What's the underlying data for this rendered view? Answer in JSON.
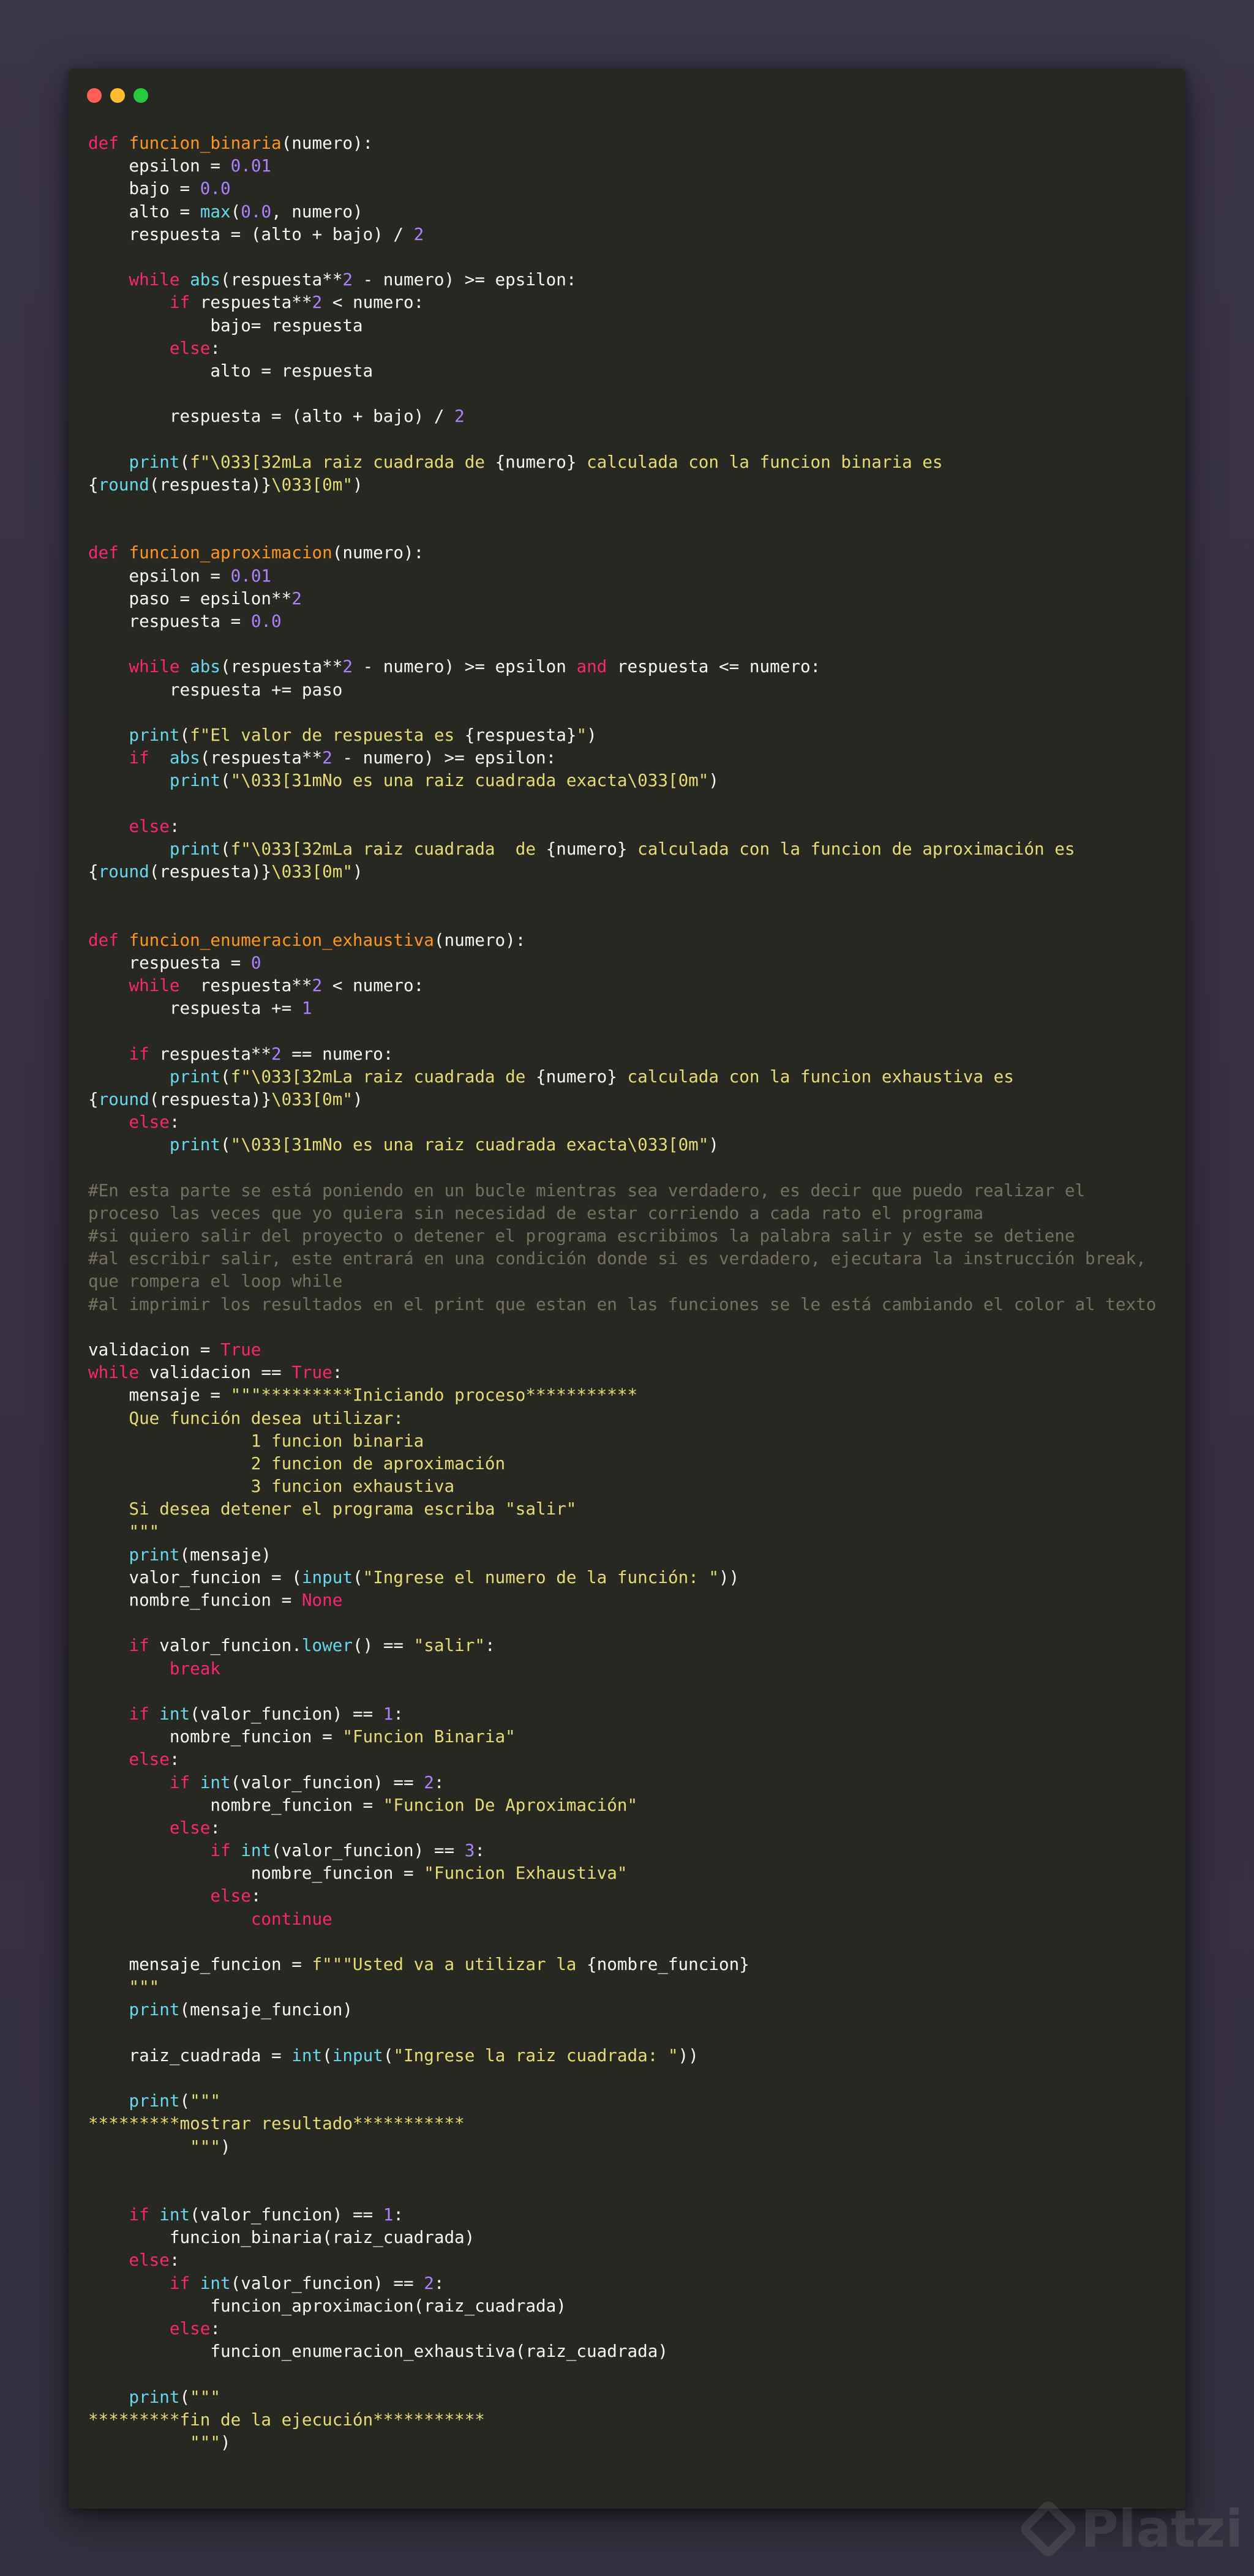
{
  "window": {
    "controls": [
      "close",
      "minimize",
      "maximize"
    ],
    "background": "#272822"
  },
  "theme": {
    "keyword": "#f92672",
    "function_name": "#fd971f",
    "builtin": "#66d9ef",
    "number": "#ae81ff",
    "string": "#e6db74",
    "comment": "#75715e",
    "text": "#f8f8f2"
  },
  "code_lines": [
    [
      [
        "kw",
        "def "
      ],
      [
        "fn",
        "funcion_binaria"
      ],
      [
        "",
        "(numero):"
      ]
    ],
    [
      [
        "",
        "    epsilon = "
      ],
      [
        "nm",
        "0.01"
      ]
    ],
    [
      [
        "",
        "    bajo = "
      ],
      [
        "nm",
        "0.0"
      ]
    ],
    [
      [
        "",
        "    alto = "
      ],
      [
        "bi",
        "max"
      ],
      [
        "",
        "("
      ],
      [
        "nm",
        "0.0"
      ],
      [
        "",
        ", numero)"
      ]
    ],
    [
      [
        "",
        "    respuesta = (alto + bajo) / "
      ],
      [
        "nm",
        "2"
      ]
    ],
    [],
    [
      [
        "",
        "    "
      ],
      [
        "kw",
        "while "
      ],
      [
        "bi",
        "abs"
      ],
      [
        "",
        "(respuesta**"
      ],
      [
        "nm",
        "2"
      ],
      [
        "",
        " - numero) >= epsilon:"
      ]
    ],
    [
      [
        "",
        "        "
      ],
      [
        "kw",
        "if "
      ],
      [
        "",
        "respuesta**"
      ],
      [
        "nm",
        "2"
      ],
      [
        "",
        " < numero:"
      ]
    ],
    [
      [
        "",
        "            bajo= respuesta"
      ]
    ],
    [
      [
        "",
        "        "
      ],
      [
        "kw",
        "else"
      ],
      [
        "",
        ":"
      ]
    ],
    [
      [
        "",
        "            alto = respuesta"
      ]
    ],
    [],
    [
      [
        "",
        "        respuesta = (alto + bajo) / "
      ],
      [
        "nm",
        "2"
      ]
    ],
    [],
    [
      [
        "",
        "    "
      ],
      [
        "bi",
        "print"
      ],
      [
        "",
        "("
      ],
      [
        "st",
        "f\"\\033[32mLa raiz cuadrada de "
      ],
      [
        "",
        "{numero}"
      ],
      [
        "st",
        " calculada con la funcion binaria es"
      ]
    ],
    [
      [
        "",
        "{"
      ],
      [
        "bi",
        "round"
      ],
      [
        "",
        "(respuesta)}"
      ],
      [
        "st",
        "\\033[0m\""
      ],
      [
        "",
        ")"
      ]
    ],
    [],
    [],
    [
      [
        "kw",
        "def "
      ],
      [
        "fn",
        "funcion_aproximacion"
      ],
      [
        "",
        "(numero):"
      ]
    ],
    [
      [
        "",
        "    epsilon = "
      ],
      [
        "nm",
        "0.01"
      ]
    ],
    [
      [
        "",
        "    paso = epsilon**"
      ],
      [
        "nm",
        "2"
      ]
    ],
    [
      [
        "",
        "    respuesta = "
      ],
      [
        "nm",
        "0.0"
      ]
    ],
    [],
    [
      [
        "",
        "    "
      ],
      [
        "kw",
        "while "
      ],
      [
        "bi",
        "abs"
      ],
      [
        "",
        "(respuesta**"
      ],
      [
        "nm",
        "2"
      ],
      [
        "",
        " - numero) >= epsilon "
      ],
      [
        "kw",
        "and"
      ],
      [
        "",
        " respuesta <= numero:"
      ]
    ],
    [
      [
        "",
        "        respuesta += paso"
      ]
    ],
    [],
    [
      [
        "",
        "    "
      ],
      [
        "bi",
        "print"
      ],
      [
        "",
        "("
      ],
      [
        "st",
        "f\"El valor de respuesta es "
      ],
      [
        "",
        "{respuesta}"
      ],
      [
        "st",
        "\""
      ],
      [
        "",
        ")"
      ]
    ],
    [
      [
        "",
        "    "
      ],
      [
        "kw",
        "if"
      ],
      [
        "",
        "  "
      ],
      [
        "bi",
        "abs"
      ],
      [
        "",
        "(respuesta**"
      ],
      [
        "nm",
        "2"
      ],
      [
        "",
        " - numero) >= epsilon:"
      ]
    ],
    [
      [
        "",
        "        "
      ],
      [
        "bi",
        "print"
      ],
      [
        "",
        "("
      ],
      [
        "st",
        "\"\\033[31mNo es una raiz cuadrada exacta\\033[0m\""
      ],
      [
        "",
        ")"
      ]
    ],
    [],
    [
      [
        "",
        "    "
      ],
      [
        "kw",
        "else"
      ],
      [
        "",
        ":"
      ]
    ],
    [
      [
        "",
        "        "
      ],
      [
        "bi",
        "print"
      ],
      [
        "",
        "("
      ],
      [
        "st",
        "f\"\\033[32mLa raiz cuadrada  de "
      ],
      [
        "",
        "{numero}"
      ],
      [
        "st",
        " calculada con la funcion de aproximación es"
      ]
    ],
    [
      [
        "",
        "{"
      ],
      [
        "bi",
        "round"
      ],
      [
        "",
        "(respuesta)}"
      ],
      [
        "st",
        "\\033[0m\""
      ],
      [
        "",
        ")"
      ]
    ],
    [],
    [],
    [
      [
        "kw",
        "def "
      ],
      [
        "fn",
        "funcion_enumeracion_exhaustiva"
      ],
      [
        "",
        "(numero):"
      ]
    ],
    [
      [
        "",
        "    respuesta = "
      ],
      [
        "nm",
        "0"
      ]
    ],
    [
      [
        "",
        "    "
      ],
      [
        "kw",
        "while"
      ],
      [
        "",
        "  respuesta**"
      ],
      [
        "nm",
        "2"
      ],
      [
        "",
        " < numero:"
      ]
    ],
    [
      [
        "",
        "        respuesta += "
      ],
      [
        "nm",
        "1"
      ]
    ],
    [],
    [
      [
        "",
        "    "
      ],
      [
        "kw",
        "if "
      ],
      [
        "",
        "respuesta**"
      ],
      [
        "nm",
        "2"
      ],
      [
        "",
        " == numero:"
      ]
    ],
    [
      [
        "",
        "        "
      ],
      [
        "bi",
        "print"
      ],
      [
        "",
        "("
      ],
      [
        "st",
        "f\"\\033[32mLa raiz cuadrada de "
      ],
      [
        "",
        "{numero}"
      ],
      [
        "st",
        " calculada con la funcion exhaustiva es"
      ]
    ],
    [
      [
        "",
        "{"
      ],
      [
        "bi",
        "round"
      ],
      [
        "",
        "(respuesta)}"
      ],
      [
        "st",
        "\\033[0m\""
      ],
      [
        "",
        ")"
      ]
    ],
    [
      [
        "",
        "    "
      ],
      [
        "kw",
        "else"
      ],
      [
        "",
        ":"
      ]
    ],
    [
      [
        "",
        "        "
      ],
      [
        "bi",
        "print"
      ],
      [
        "",
        "("
      ],
      [
        "st",
        "\"\\033[31mNo es una raiz cuadrada exacta\\033[0m\""
      ],
      [
        "",
        ")"
      ]
    ],
    [],
    [
      [
        "cm",
        "#En esta parte se está poniendo en un bucle mientras sea verdadero, es decir que puedo realizar el"
      ]
    ],
    [
      [
        "cm",
        "proceso las veces que yo quiera sin necesidad de estar corriendo a cada rato el programa"
      ]
    ],
    [
      [
        "cm",
        "#si quiero salir del proyecto o detener el programa escribimos la palabra salir y este se detiene"
      ]
    ],
    [
      [
        "cm",
        "#al escribir salir, este entrará en una condición donde si es verdadero, ejecutara la instrucción break,"
      ]
    ],
    [
      [
        "cm",
        "que rompera el loop while"
      ]
    ],
    [
      [
        "cm",
        "#al imprimir los resultados en el print que estan en las funciones se le está cambiando el color al texto"
      ]
    ],
    [],
    [
      [
        "",
        "validacion = "
      ],
      [
        "kw",
        "True"
      ]
    ],
    [
      [
        "kw",
        "while"
      ],
      [
        "",
        " validacion == "
      ],
      [
        "kw",
        "True"
      ],
      [
        "",
        ":"
      ]
    ],
    [
      [
        "",
        "    mensaje = "
      ],
      [
        "st",
        "\"\"\"*********Iniciando proceso***********"
      ]
    ],
    [
      [
        "st",
        "    Que función desea utilizar:"
      ]
    ],
    [
      [
        "st",
        "                1 funcion binaria"
      ]
    ],
    [
      [
        "st",
        "                2 funcion de aproximación"
      ]
    ],
    [
      [
        "st",
        "                3 funcion exhaustiva"
      ]
    ],
    [
      [
        "st",
        "    Si desea detener el programa escriba \"salir\""
      ]
    ],
    [
      [
        "st",
        "    \"\"\""
      ]
    ],
    [
      [
        "",
        "    "
      ],
      [
        "bi",
        "print"
      ],
      [
        "",
        "(mensaje)"
      ]
    ],
    [
      [
        "",
        "    valor_funcion = ("
      ],
      [
        "bi",
        "input"
      ],
      [
        "",
        "("
      ],
      [
        "st",
        "\"Ingrese el numero de la función: \""
      ],
      [
        "",
        "))"
      ]
    ],
    [
      [
        "",
        "    nombre_funcion = "
      ],
      [
        "kw",
        "None"
      ]
    ],
    [],
    [
      [
        "",
        "    "
      ],
      [
        "kw",
        "if "
      ],
      [
        "",
        "valor_funcion."
      ],
      [
        "bi",
        "lower"
      ],
      [
        "",
        "() == "
      ],
      [
        "st",
        "\"salir\""
      ],
      [
        "",
        ":"
      ]
    ],
    [
      [
        "",
        "        "
      ],
      [
        "kw",
        "break"
      ]
    ],
    [],
    [
      [
        "",
        "    "
      ],
      [
        "kw",
        "if "
      ],
      [
        "bi",
        "int"
      ],
      [
        "",
        "(valor_funcion) == "
      ],
      [
        "nm",
        "1"
      ],
      [
        "",
        ":"
      ]
    ],
    [
      [
        "",
        "        nombre_funcion = "
      ],
      [
        "st",
        "\"Funcion Binaria\""
      ]
    ],
    [
      [
        "",
        "    "
      ],
      [
        "kw",
        "else"
      ],
      [
        "",
        ":"
      ]
    ],
    [
      [
        "",
        "        "
      ],
      [
        "kw",
        "if "
      ],
      [
        "bi",
        "int"
      ],
      [
        "",
        "(valor_funcion) == "
      ],
      [
        "nm",
        "2"
      ],
      [
        "",
        ":"
      ]
    ],
    [
      [
        "",
        "            nombre_funcion = "
      ],
      [
        "st",
        "\"Funcion De Aproximación\""
      ]
    ],
    [
      [
        "",
        "        "
      ],
      [
        "kw",
        "else"
      ],
      [
        "",
        ":"
      ]
    ],
    [
      [
        "",
        "            "
      ],
      [
        "kw",
        "if "
      ],
      [
        "bi",
        "int"
      ],
      [
        "",
        "(valor_funcion) == "
      ],
      [
        "nm",
        "3"
      ],
      [
        "",
        ":"
      ]
    ],
    [
      [
        "",
        "                nombre_funcion = "
      ],
      [
        "st",
        "\"Funcion Exhaustiva\""
      ]
    ],
    [
      [
        "",
        "            "
      ],
      [
        "kw",
        "else"
      ],
      [
        "",
        ":"
      ]
    ],
    [
      [
        "",
        "                "
      ],
      [
        "kw",
        "continue"
      ]
    ],
    [],
    [
      [
        "",
        "    mensaje_funcion = "
      ],
      [
        "st",
        "f\"\"\"Usted va a utilizar la "
      ],
      [
        "",
        "{nombre_funcion}"
      ]
    ],
    [
      [
        "st",
        "    \"\"\""
      ]
    ],
    [
      [
        "",
        "    "
      ],
      [
        "bi",
        "print"
      ],
      [
        "",
        "(mensaje_funcion)"
      ]
    ],
    [],
    [
      [
        "",
        "    raiz_cuadrada = "
      ],
      [
        "bi",
        "int"
      ],
      [
        "",
        "("
      ],
      [
        "bi",
        "input"
      ],
      [
        "",
        "("
      ],
      [
        "st",
        "\"Ingrese la raiz cuadrada: \""
      ],
      [
        "",
        "))"
      ]
    ],
    [],
    [
      [
        "",
        "    "
      ],
      [
        "bi",
        "print"
      ],
      [
        "",
        "("
      ],
      [
        "st",
        "\"\"\""
      ]
    ],
    [
      [
        "st",
        "*********mostrar resultado***********"
      ]
    ],
    [
      [
        "st",
        "          \"\"\""
      ],
      [
        "",
        ")"
      ]
    ],
    [],
    [],
    [
      [
        "",
        "    "
      ],
      [
        "kw",
        "if "
      ],
      [
        "bi",
        "int"
      ],
      [
        "",
        "(valor_funcion) == "
      ],
      [
        "nm",
        "1"
      ],
      [
        "",
        ":"
      ]
    ],
    [
      [
        "",
        "        funcion_binaria(raiz_cuadrada)"
      ]
    ],
    [
      [
        "",
        "    "
      ],
      [
        "kw",
        "else"
      ],
      [
        "",
        ":"
      ]
    ],
    [
      [
        "",
        "        "
      ],
      [
        "kw",
        "if "
      ],
      [
        "bi",
        "int"
      ],
      [
        "",
        "(valor_funcion) == "
      ],
      [
        "nm",
        "2"
      ],
      [
        "",
        ":"
      ]
    ],
    [
      [
        "",
        "            funcion_aproximacion(raiz_cuadrada)"
      ]
    ],
    [
      [
        "",
        "        "
      ],
      [
        "kw",
        "else"
      ],
      [
        "",
        ":"
      ]
    ],
    [
      [
        "",
        "            funcion_enumeracion_exhaustiva(raiz_cuadrada)"
      ]
    ],
    [],
    [
      [
        "",
        "    "
      ],
      [
        "bi",
        "print"
      ],
      [
        "",
        "("
      ],
      [
        "st",
        "\"\"\""
      ]
    ],
    [
      [
        "st",
        "*********fin de la ejecución***********"
      ]
    ],
    [
      [
        "st",
        "          \"\"\""
      ],
      [
        "",
        ")"
      ]
    ]
  ],
  "watermark": {
    "text": "Platzi"
  }
}
